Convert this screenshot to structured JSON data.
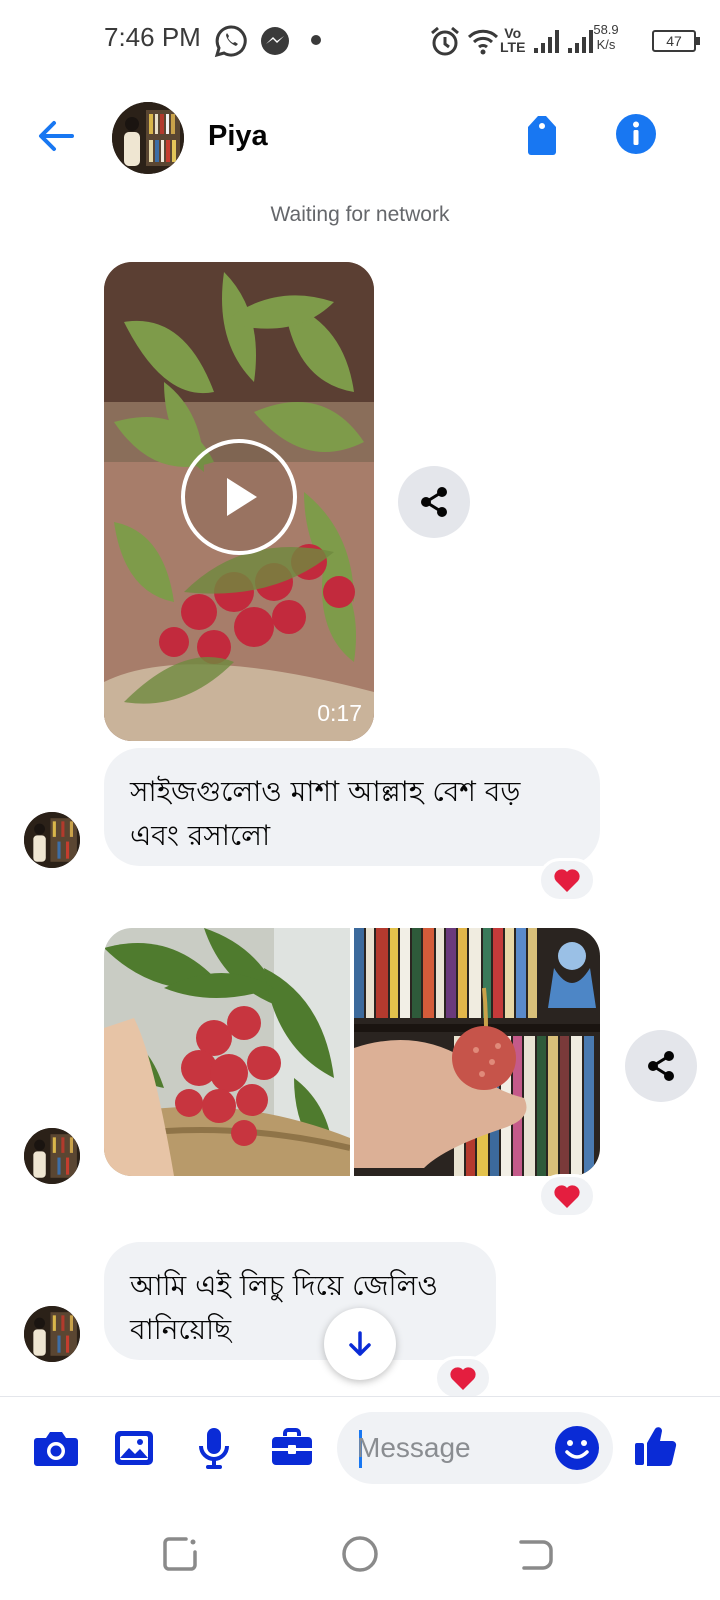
{
  "status_bar": {
    "time": "7:46 PM",
    "network_speed_value": "58.9",
    "network_speed_unit": "K/s",
    "battery": "47",
    "icons": [
      "whatsapp-icon",
      "messenger-icon",
      "notification-dot",
      "alarm-icon",
      "wifi-icon",
      "volte-icon",
      "signal-icon",
      "signal-icon"
    ],
    "volte_label_top": "Vo",
    "volte_label_bottom": "LTE"
  },
  "header": {
    "contact_name": "Piya",
    "icons": [
      "back-arrow-icon",
      "tag-icon",
      "info-icon"
    ],
    "accent_color": "#1877f2"
  },
  "network_note": "Waiting for network",
  "messages": [
    {
      "type": "video",
      "duration": "0:17"
    },
    {
      "type": "text",
      "text": "সাইজগুলোও মাশা আল্লাহ বেশ বড় এবং রসালো",
      "reaction": "heart"
    },
    {
      "type": "photos",
      "count": 2,
      "reaction": "heart"
    },
    {
      "type": "text",
      "text": "আমি এই লিচু দিয়ে জেলিও বানিয়েছি",
      "reaction": "heart"
    }
  ],
  "composer": {
    "placeholder": "Message",
    "icons": [
      "camera-icon",
      "gallery-icon",
      "microphone-icon",
      "briefcase-icon",
      "emoji-icon",
      "thumbs-up-icon"
    ],
    "icon_color": "#0a2bd6"
  },
  "nav_bar": {
    "icons": [
      "recents-icon",
      "home-icon",
      "back-icon"
    ]
  }
}
